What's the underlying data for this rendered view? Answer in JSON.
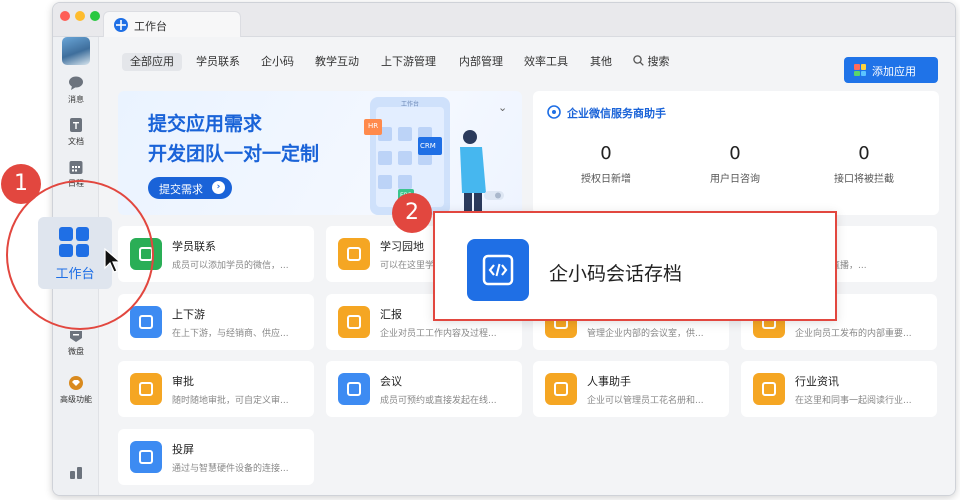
{
  "window": {
    "tab_title": "工作台"
  },
  "sidebar": {
    "items": [
      {
        "label": "消息",
        "icon": "chat-bubble-icon"
      },
      {
        "label": "文档",
        "icon": "document-icon"
      },
      {
        "label": "日程",
        "icon": "calendar-icon"
      },
      {
        "label": "微盘",
        "icon": "cloud-drive-icon"
      },
      {
        "label": "高级功能",
        "icon": "advanced-features-icon"
      }
    ],
    "workbench_label": "工作台"
  },
  "nav": {
    "tabs": [
      "全部应用",
      "学员联系",
      "企小码",
      "教学互动",
      "上下游管理",
      "内部管理",
      "效率工具",
      "其他"
    ],
    "search_label": "搜索",
    "add_button": "添加应用"
  },
  "banner": {
    "line1": "提交应用需求",
    "line2": "开发团队一对一定制",
    "button": "提交需求",
    "illustration_tags": [
      "HR",
      "CRM",
      "ERP"
    ],
    "illustration_header": "工作台"
  },
  "service": {
    "title": "企业微信服务商助手",
    "stats": [
      {
        "value": "0",
        "label": "授权日新增"
      },
      {
        "value": "0",
        "label": "用户日咨询"
      },
      {
        "value": "0",
        "label": "接口将被拦截"
      }
    ]
  },
  "apps": [
    {
      "title": "学员联系",
      "desc": "成员可以添加学员的微信，...",
      "color": "#2aae56",
      "icon": "contact-icon"
    },
    {
      "title": "学习园地",
      "desc": "可以在这里学习...",
      "color": "#f5a623",
      "icon": "planet-icon"
    },
    {
      "title": "",
      "desc": "发起上课直播，...",
      "color": "#f5a623",
      "icon": "live-icon"
    },
    {
      "title": "上下游",
      "desc": "在上下游，与经销商、供应...",
      "color": "#3d8bf2",
      "icon": "link-icon"
    },
    {
      "title": "汇报",
      "desc": "企业对员工工作内容及过程...",
      "color": "#f5a623",
      "icon": "report-icon"
    },
    {
      "title": "",
      "desc": "管理企业内部的会议室，供...",
      "color": "#f5a623",
      "icon": "meeting-room-icon"
    },
    {
      "title": "",
      "desc": "企业向员工发布的内部重要...",
      "color": "#f5a623",
      "icon": "announcement-icon"
    },
    {
      "title": "审批",
      "desc": "随时随地审批，可自定义审...",
      "color": "#f5a623",
      "icon": "stamp-icon"
    },
    {
      "title": "会议",
      "desc": "成员可预约或直接发起在线...",
      "color": "#3d8bf2",
      "icon": "video-meeting-icon"
    },
    {
      "title": "人事助手",
      "desc": "企业可以管理员工花名册和...",
      "color": "#f5a623",
      "icon": "person-icon"
    },
    {
      "title": "行业资讯",
      "desc": "在这里和同事一起阅读行业...",
      "color": "#f5a623",
      "icon": "news-icon"
    },
    {
      "title": "投屏",
      "desc": "通过与智慧硬件设备的连接...",
      "color": "#3d8bf2",
      "icon": "screen-cast-icon"
    }
  ],
  "popup": {
    "title": "企小码会话存档",
    "icon": "code-icon"
  },
  "annotations": {
    "badge1": "1",
    "badge2": "2"
  },
  "colors": {
    "accent": "#1f73e8",
    "highlight": "#e2473f",
    "orange": "#f5a623",
    "green": "#2aae56"
  }
}
